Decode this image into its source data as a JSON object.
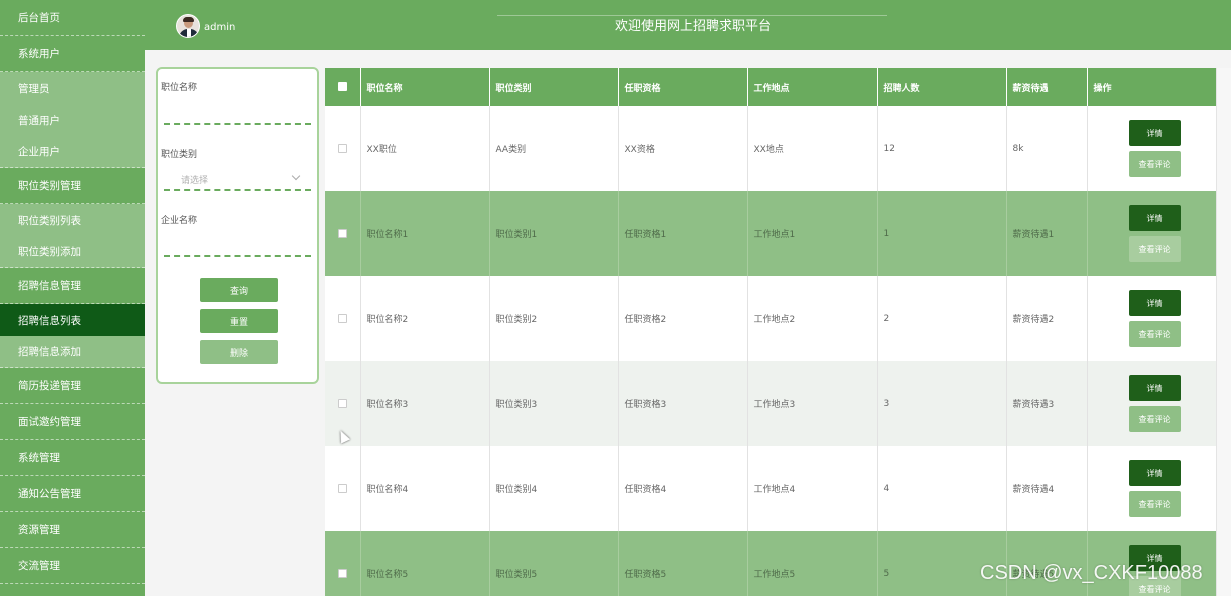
{
  "sidebar": {
    "items": [
      {
        "label": "后台首页"
      },
      {
        "label": "系统用户"
      },
      {
        "label": "管理员"
      },
      {
        "label": "普通用户"
      },
      {
        "label": "企业用户"
      },
      {
        "label": "职位类别管理"
      },
      {
        "label": "职位类别列表"
      },
      {
        "label": "职位类别添加"
      },
      {
        "label": "招聘信息管理"
      },
      {
        "label": "招聘信息列表"
      },
      {
        "label": "招聘信息添加"
      },
      {
        "label": "简历投递管理"
      },
      {
        "label": "面试邀约管理"
      },
      {
        "label": "系统管理"
      },
      {
        "label": "通知公告管理"
      },
      {
        "label": "资源管理"
      },
      {
        "label": "交流管理"
      }
    ]
  },
  "header": {
    "username": "admin",
    "title": "欢迎使用网上招聘求职平台"
  },
  "search": {
    "job_name_label": "职位名称",
    "job_category_label": "职位类别",
    "job_category_placeholder": "请选择",
    "company_name_label": "企业名称",
    "query_button": "查询",
    "reset_button": "重置",
    "delete_button": "删除"
  },
  "table": {
    "headers": [
      "职位名称",
      "职位类别",
      "任职资格",
      "工作地点",
      "招聘人数",
      "薪资待遇",
      "操作"
    ],
    "detail_label": "详情",
    "review_label": "查看评论",
    "rows": [
      {
        "name": "XX职位",
        "category": "AA类别",
        "qualification": "XX资格",
        "location": "XX地点",
        "count": "12",
        "salary": "8k"
      },
      {
        "name": "职位名称1",
        "category": "职位类别1",
        "qualification": "任职资格1",
        "location": "工作地点1",
        "count": "1",
        "salary": "薪资待遇1"
      },
      {
        "name": "职位名称2",
        "category": "职位类别2",
        "qualification": "任职资格2",
        "location": "工作地点2",
        "count": "2",
        "salary": "薪资待遇2"
      },
      {
        "name": "职位名称3",
        "category": "职位类别3",
        "qualification": "任职资格3",
        "location": "工作地点3",
        "count": "3",
        "salary": "薪资待遇3"
      },
      {
        "name": "职位名称4",
        "category": "职位类别4",
        "qualification": "任职资格4",
        "location": "工作地点4",
        "count": "4",
        "salary": "薪资待遇4"
      },
      {
        "name": "职位名称5",
        "category": "职位类别5",
        "qualification": "任职资格5",
        "location": "工作地点5",
        "count": "5",
        "salary": "薪资待遇5"
      }
    ]
  },
  "watermark": "CSDN @vx_CXKF10088",
  "colors": {
    "primary": "#6aab5e",
    "light": "#8fbf86",
    "dark": "#0f5a17"
  }
}
